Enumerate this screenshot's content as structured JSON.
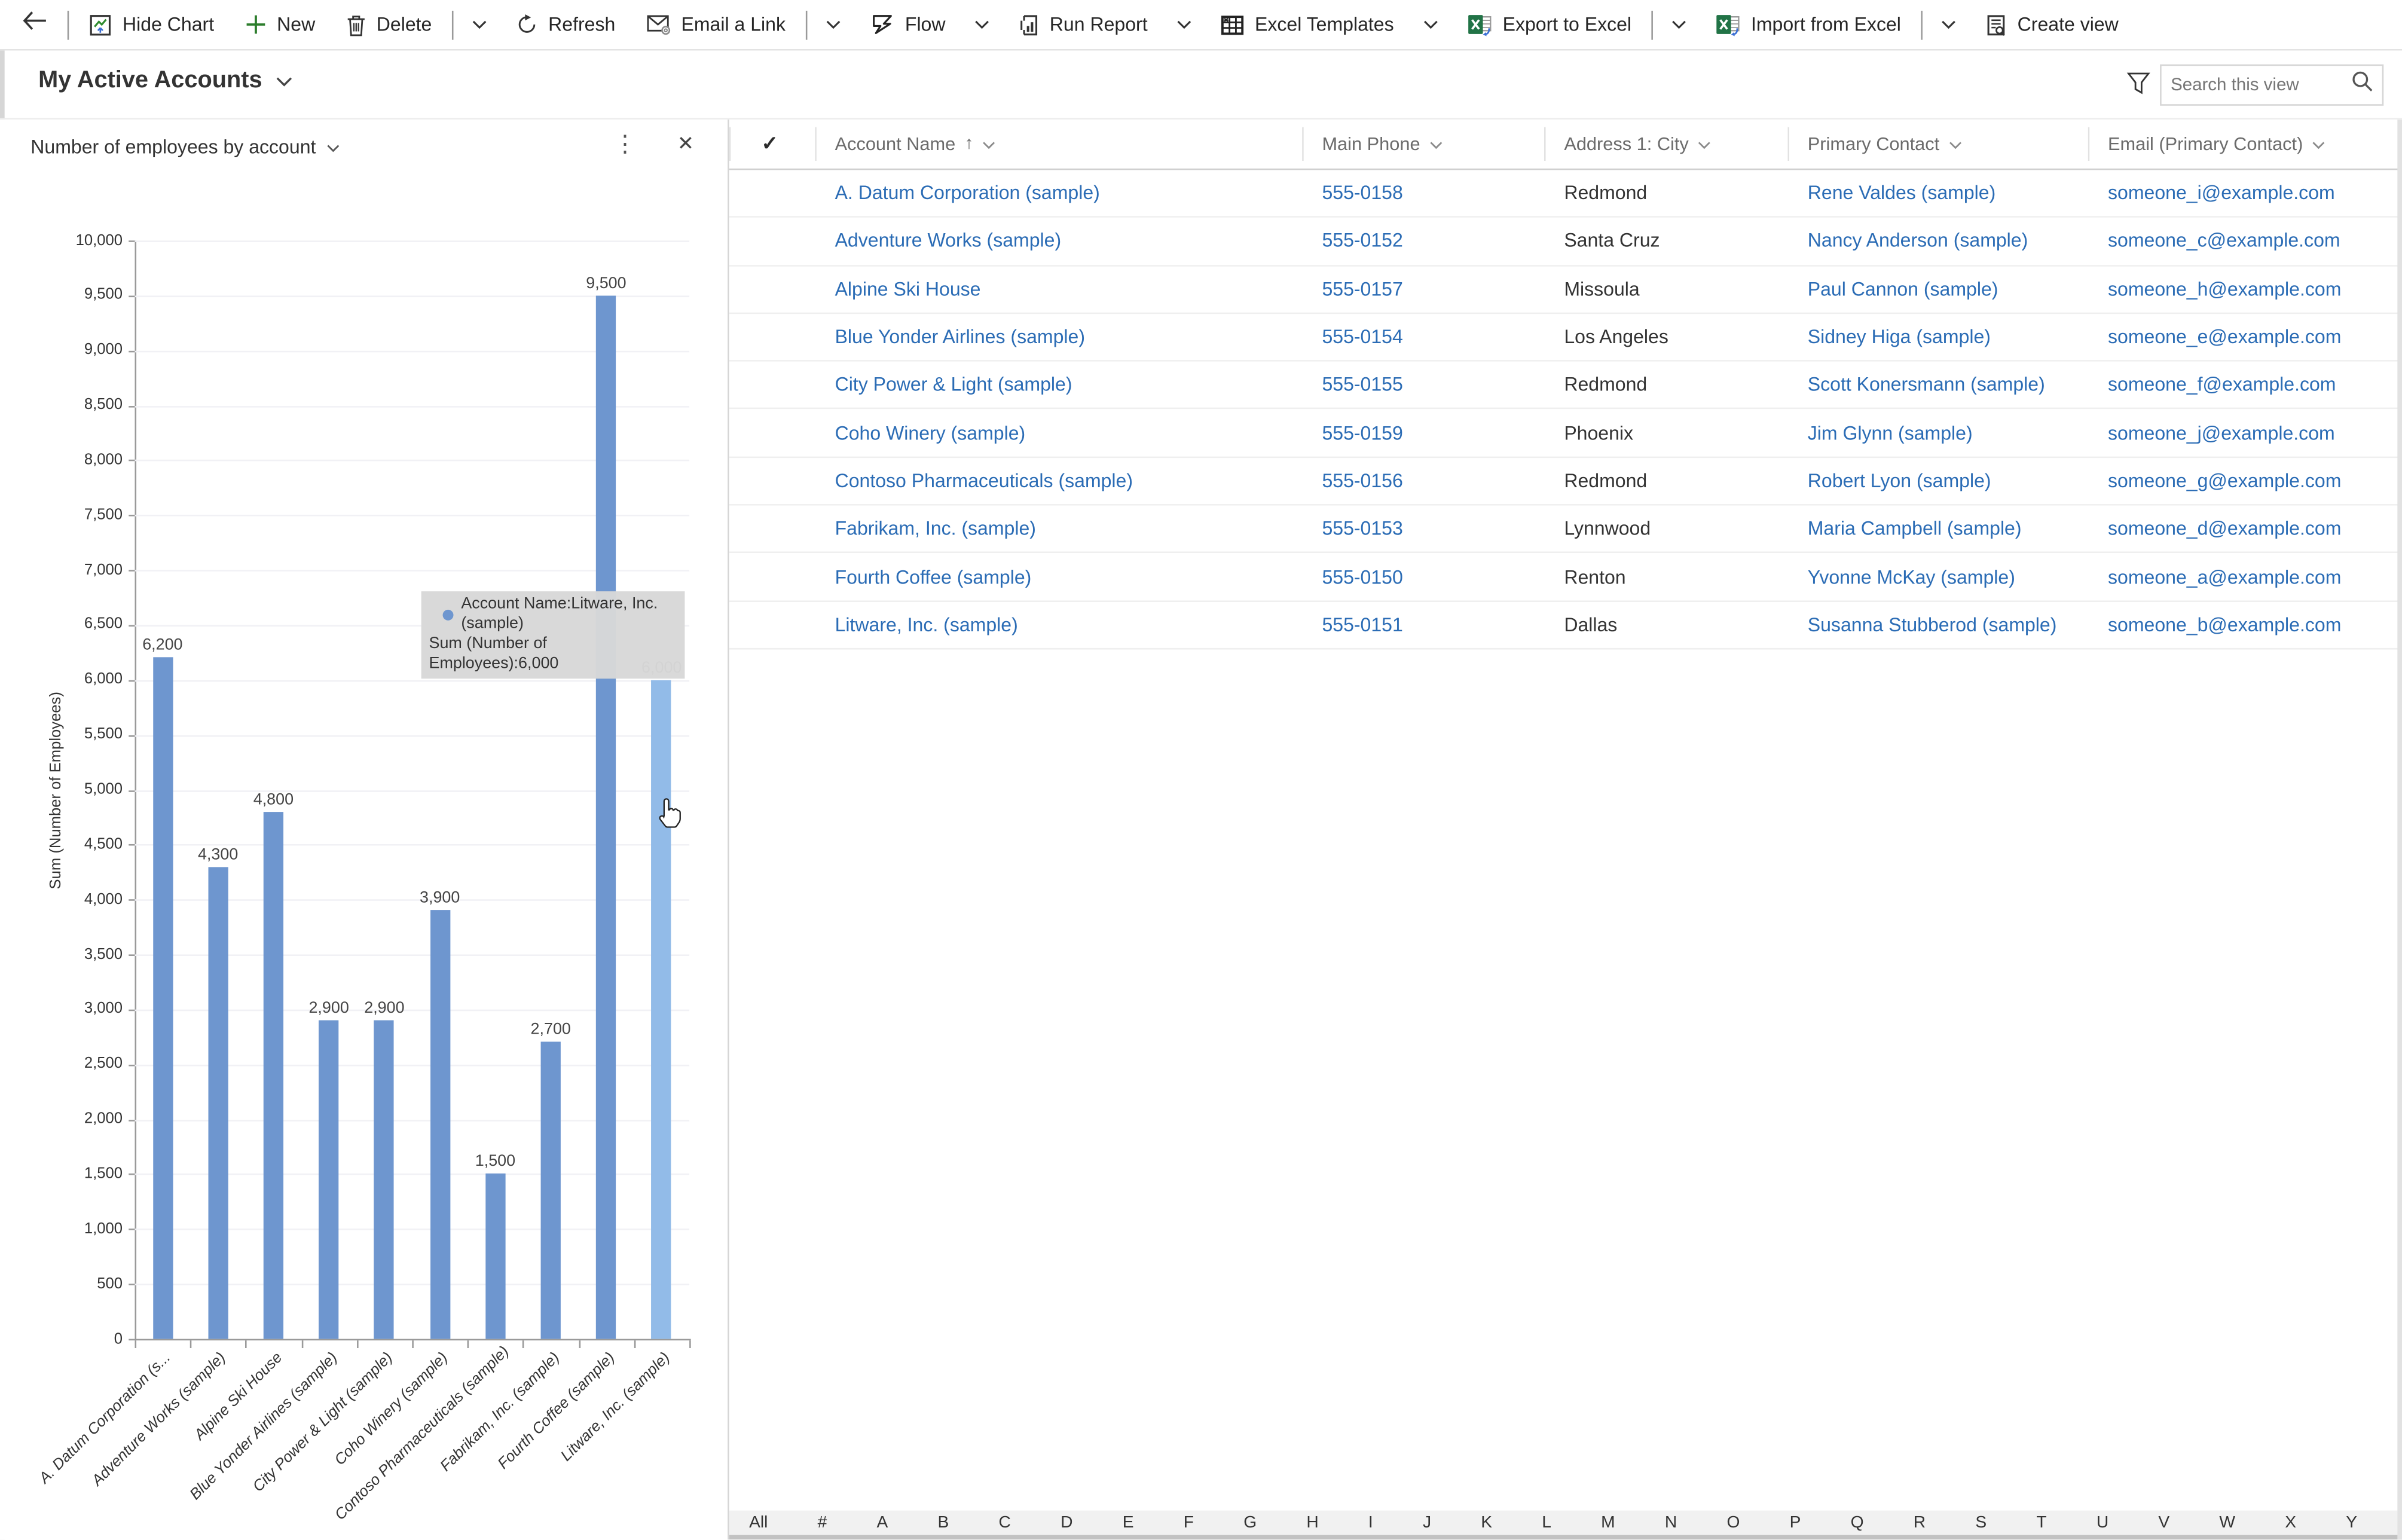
{
  "toolbar": {
    "back_label": "Back",
    "items": [
      {
        "label": "Hide Chart",
        "icon": "hide-chart"
      },
      {
        "label": "New",
        "icon": "plus"
      },
      {
        "label": "Delete",
        "icon": "trash",
        "after": "split"
      },
      {
        "label": "Refresh",
        "icon": "refresh"
      },
      {
        "label": "Email a Link",
        "icon": "email-link",
        "after": "split"
      },
      {
        "label": "Flow",
        "icon": "flow",
        "after": "chevron"
      },
      {
        "label": "Run Report",
        "icon": "report",
        "after": "chevron"
      },
      {
        "label": "Excel Templates",
        "icon": "excel-grid",
        "after": "chevron"
      },
      {
        "label": "Export to Excel",
        "icon": "excel-green",
        "after": "split"
      },
      {
        "label": "Import from Excel",
        "icon": "excel-green",
        "after": "split"
      },
      {
        "label": "Create view",
        "icon": "create-view"
      }
    ]
  },
  "view_header": {
    "title": "My Active Accounts",
    "search_placeholder": "Search this view"
  },
  "chart_panel": {
    "title": "Number of employees by account",
    "tooltip_line1": "Account Name:Litware, Inc. (sample)",
    "tooltip_line2": "Sum (Number of Employees):6,000"
  },
  "chart_data": {
    "type": "bar",
    "title": "Number of employees by account",
    "xlabel": "",
    "ylabel": "Sum (Number of Employees)",
    "ylim": [
      0,
      10000
    ],
    "ytick_step": 500,
    "grid": true,
    "legend": "none",
    "categories": [
      "A. Datum Corporation (s...",
      "Adventure Works (sample)",
      "Alpine Ski House",
      "Blue Yonder Airlines (sample)",
      "City Power & Light (sample)",
      "Coho Winery (sample)",
      "Contoso Pharmaceuticals (sample)",
      "Fabrikam, Inc. (sample)",
      "Fourth Coffee (sample)",
      "Litware, Inc. (sample)"
    ],
    "values": [
      6200,
      4300,
      4800,
      2900,
      2900,
      3900,
      1500,
      2700,
      9500,
      6000
    ],
    "value_labels": [
      "6,200",
      "4,300",
      "4,800",
      "2,900",
      "2,900",
      "3,900",
      "1,500",
      "2,700",
      "9,500",
      "6,000"
    ],
    "highlighted_index": 9,
    "bar_color": "#6e96cf",
    "highlight_color": "#92bbe8"
  },
  "grid": {
    "columns": [
      {
        "label": "Account Name",
        "sorted": "asc"
      },
      {
        "label": "Main Phone"
      },
      {
        "label": "Address 1: City"
      },
      {
        "label": "Primary Contact"
      },
      {
        "label": "Email (Primary Contact)"
      }
    ],
    "rows": [
      {
        "account": "A. Datum Corporation (sample)",
        "phone": "555-0158",
        "city": "Redmond",
        "contact": "Rene Valdes (sample)",
        "email": "someone_i@example.com"
      },
      {
        "account": "Adventure Works (sample)",
        "phone": "555-0152",
        "city": "Santa Cruz",
        "contact": "Nancy Anderson (sample)",
        "email": "someone_c@example.com"
      },
      {
        "account": "Alpine Ski House",
        "phone": "555-0157",
        "city": "Missoula",
        "contact": "Paul Cannon (sample)",
        "email": "someone_h@example.com"
      },
      {
        "account": "Blue Yonder Airlines (sample)",
        "phone": "555-0154",
        "city": "Los Angeles",
        "contact": "Sidney Higa (sample)",
        "email": "someone_e@example.com"
      },
      {
        "account": "City Power & Light (sample)",
        "phone": "555-0155",
        "city": "Redmond",
        "contact": "Scott Konersmann (sample)",
        "email": "someone_f@example.com"
      },
      {
        "account": "Coho Winery (sample)",
        "phone": "555-0159",
        "city": "Phoenix",
        "contact": "Jim Glynn (sample)",
        "email": "someone_j@example.com"
      },
      {
        "account": "Contoso Pharmaceuticals (sample)",
        "phone": "555-0156",
        "city": "Redmond",
        "contact": "Robert Lyon (sample)",
        "email": "someone_g@example.com"
      },
      {
        "account": "Fabrikam, Inc. (sample)",
        "phone": "555-0153",
        "city": "Lynnwood",
        "contact": "Maria Campbell (sample)",
        "email": "someone_d@example.com"
      },
      {
        "account": "Fourth Coffee (sample)",
        "phone": "555-0150",
        "city": "Renton",
        "contact": "Yvonne McKay (sample)",
        "email": "someone_a@example.com"
      },
      {
        "account": "Litware, Inc. (sample)",
        "phone": "555-0151",
        "city": "Dallas",
        "contact": "Susanna Stubberod (sample)",
        "email": "someone_b@example.com"
      }
    ],
    "jump_bar": [
      "All",
      "#",
      "A",
      "B",
      "C",
      "D",
      "E",
      "F",
      "G",
      "H",
      "I",
      "J",
      "K",
      "L",
      "M",
      "N",
      "O",
      "P",
      "Q",
      "R",
      "S",
      "T",
      "U",
      "V",
      "W",
      "X",
      "Y"
    ]
  },
  "colors": {
    "link": "#2b6cb5",
    "bar": "#6e96cf",
    "bar_highlight": "#92bbe8",
    "excel_green": "#217346"
  }
}
